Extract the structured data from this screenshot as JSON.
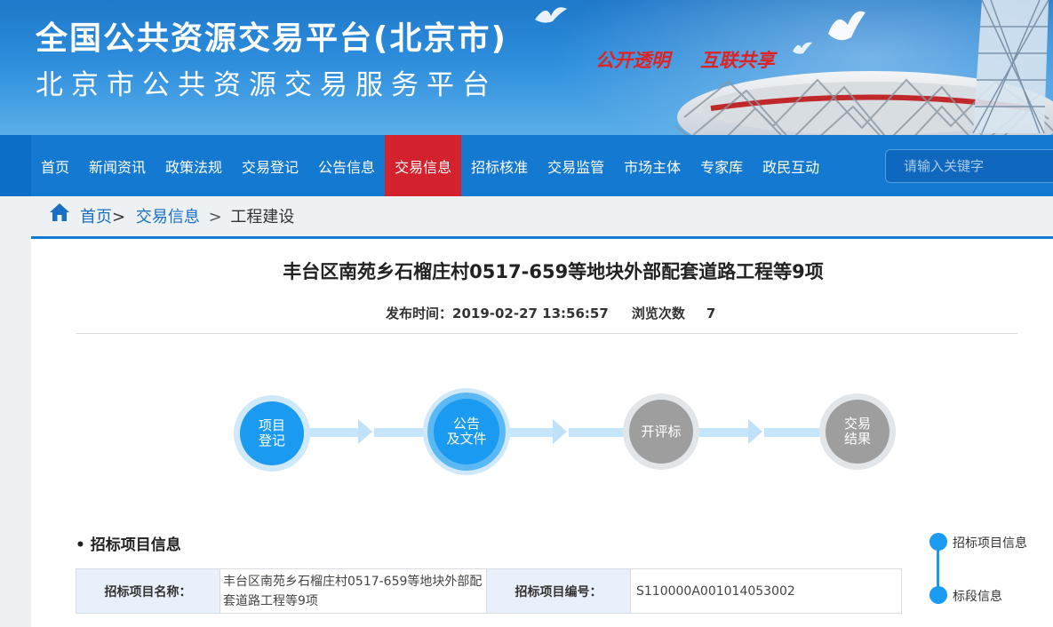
{
  "banner": {
    "title_main": "全国公共资源交易平台(北京市)",
    "title_sub": "北京市公共资源交易服务平台",
    "slogan_1": "公开透明",
    "slogan_2": "互联共享"
  },
  "nav": {
    "items": [
      {
        "label": "首页"
      },
      {
        "label": "新闻资讯"
      },
      {
        "label": "政策法规"
      },
      {
        "label": "交易登记"
      },
      {
        "label": "公告信息"
      },
      {
        "label": "交易信息",
        "active": true
      },
      {
        "label": "招标核准"
      },
      {
        "label": "交易监管"
      },
      {
        "label": "市场主体"
      },
      {
        "label": "专家库"
      },
      {
        "label": "政民互动"
      }
    ],
    "search_placeholder": "请输入关键字",
    "active_color": "#d3212d"
  },
  "breadcrumb": {
    "home": "首页",
    "level1": "交易信息",
    "level2": "工程建设",
    "sep_a": ">",
    "sep_b": ">"
  },
  "article": {
    "title": "丰台区南苑乡石榴庄村0517-659等地块外部配套道路工程等9项",
    "publish_label": "发布时间：",
    "publish_time": "2019-02-27 13:56:57",
    "views_label": "浏览次数",
    "views": "7"
  },
  "steps": [
    {
      "line1": "项目",
      "line2": "登记",
      "state": "done"
    },
    {
      "line1": "公告",
      "line2": "及文件",
      "state": "current"
    },
    {
      "line1": "开评标",
      "line2": "",
      "state": "pending"
    },
    {
      "line1": "交易",
      "line2": "结果",
      "state": "pending"
    }
  ],
  "section": {
    "title": "• 招标项目信息",
    "rows": [
      {
        "label1": "招标项目名称：",
        "value1": "丰台区南苑乡石榴庄村0517-659等地块外部配套道路工程等9项",
        "label2": "招标项目编号：",
        "value2": "S110000A001014053002"
      }
    ]
  },
  "side_nav": {
    "items": [
      {
        "label": "招标项目信息"
      },
      {
        "label": "标段信息"
      }
    ]
  },
  "colors": {
    "primary": "#1479d0",
    "accent_blue": "#1a9af0",
    "pending_gray": "#9e9e9e"
  }
}
